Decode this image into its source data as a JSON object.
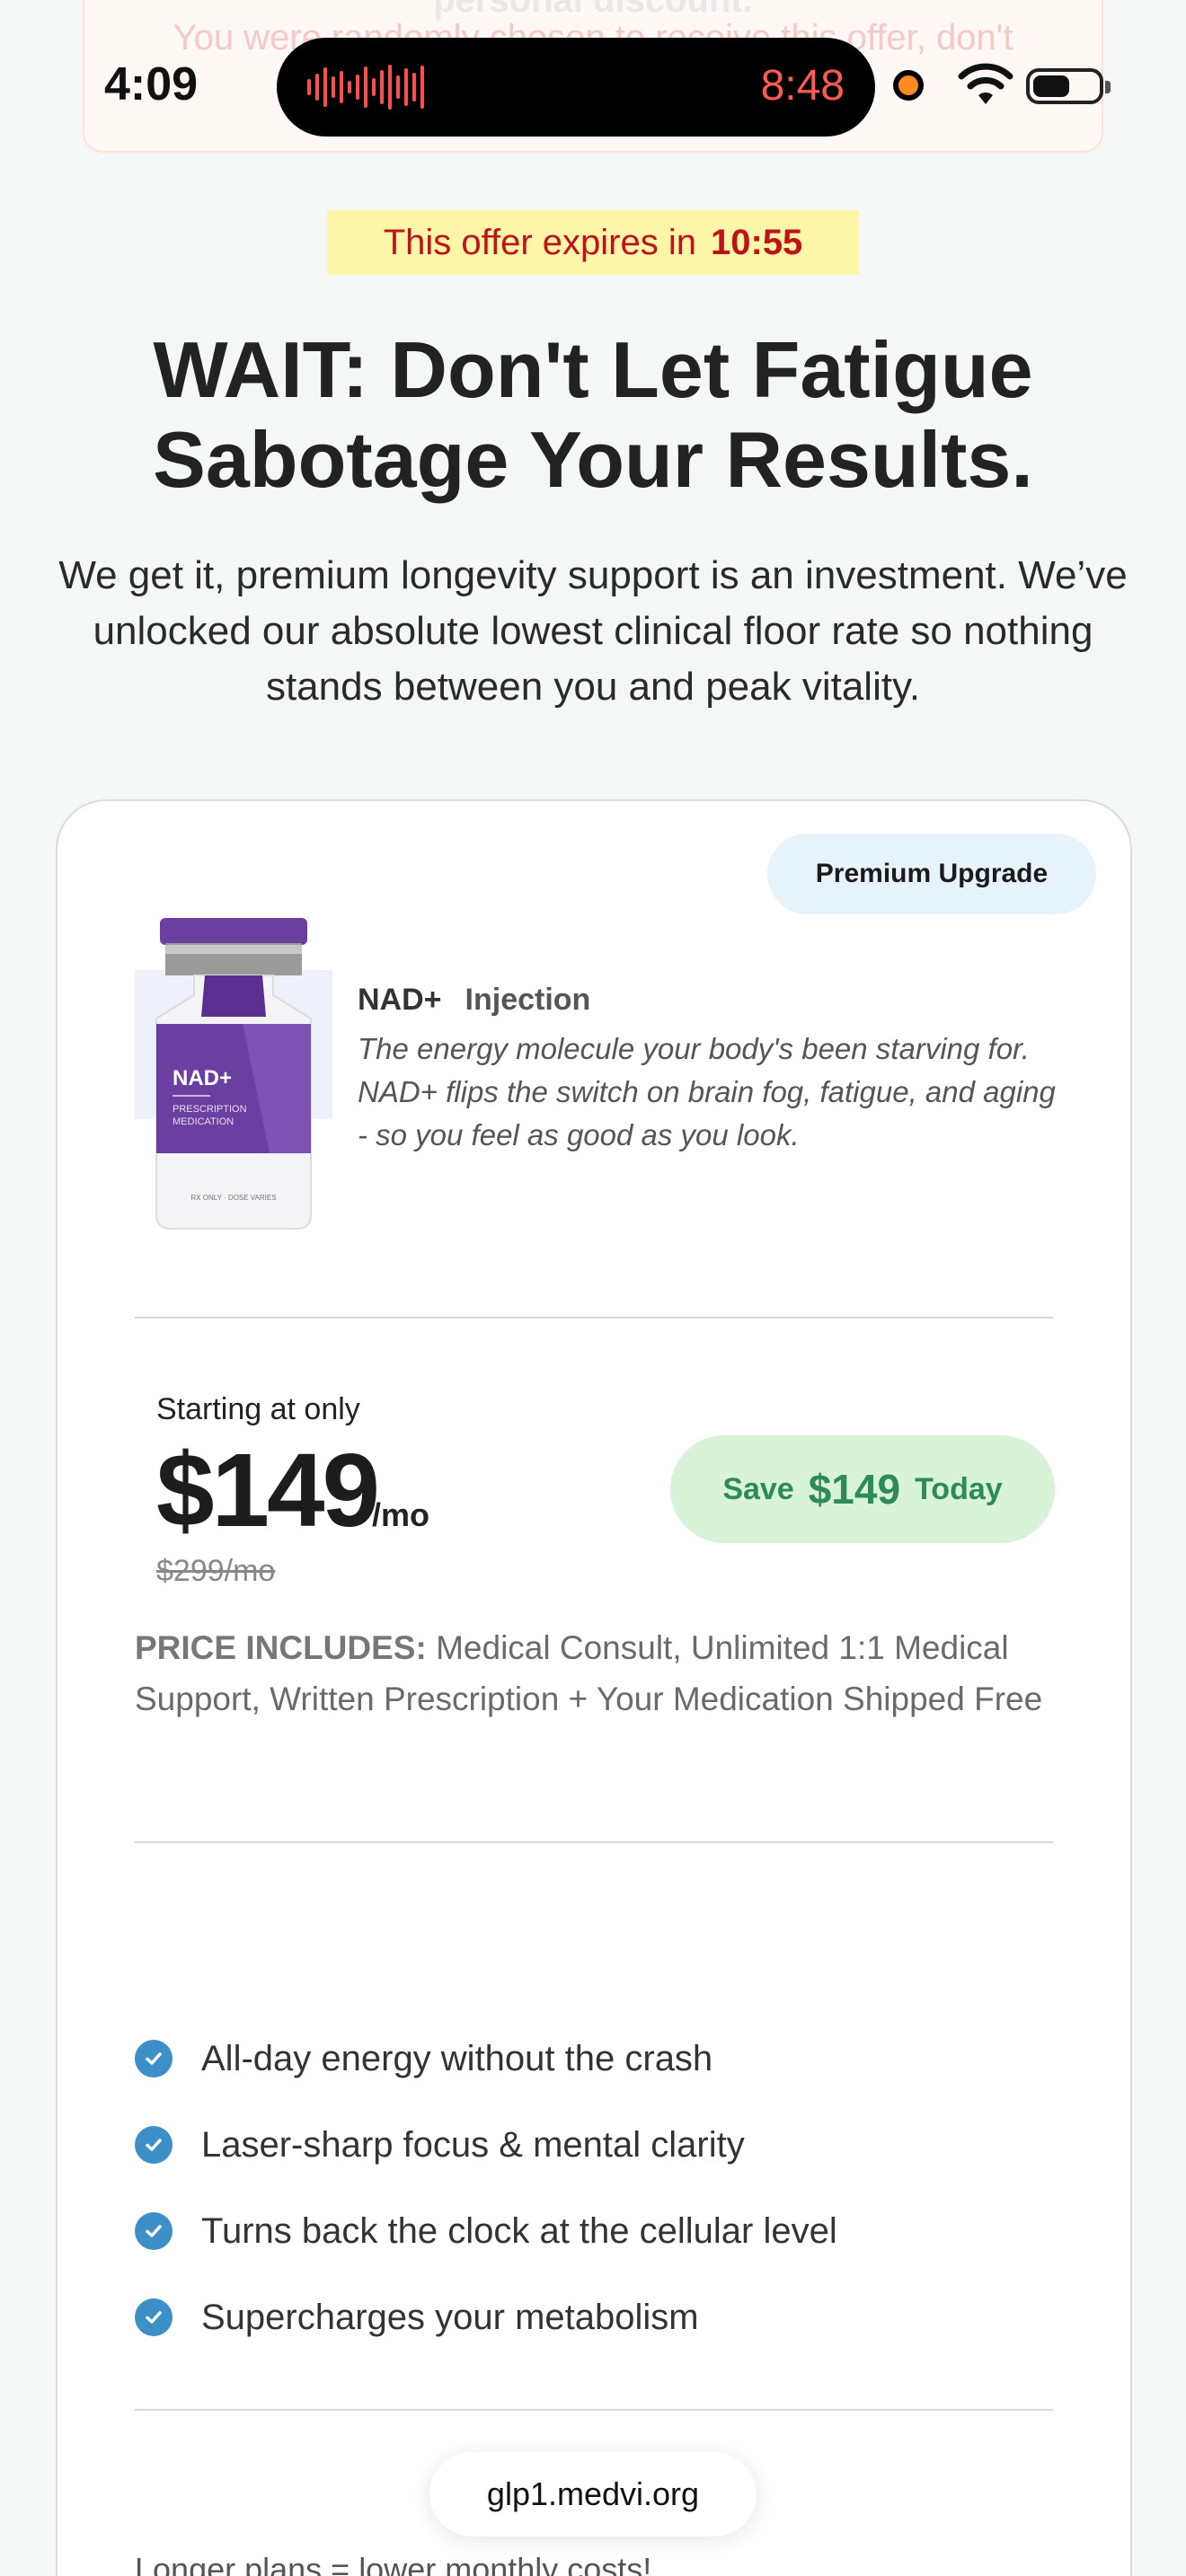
{
  "status_bar": {
    "time": "4:09",
    "recording_timer": "8:48"
  },
  "top_banner": {
    "line1": "personal discount.",
    "line2": "You were randomly chosen to receive this offer, don't"
  },
  "countdown": {
    "label": "This offer expires in",
    "time": "10:55"
  },
  "headline": "WAIT: Don't Let Fatigue Sabotage Your Results.",
  "subheadline": "We get it, premium longevity support is an investment. We’ve unlocked our absolute lowest clinical floor rate so nothing stands between you and peak vitality.",
  "card": {
    "badge": "Premium Upgrade",
    "product": {
      "name": "NAD+",
      "type": "Injection",
      "description": "The energy molecule your body's been starving for. NAD+ flips the switch on brain fog, fatigue, and aging - so you feel as good as you look.",
      "vial_label": "NAD+",
      "vial_sub1": "PRESCRIPTION",
      "vial_sub2": "MEDICATION",
      "vial_foot": "RX ONLY · DOSE VARIES"
    },
    "pricing": {
      "starting_label": "Starting at only",
      "price": "$149",
      "unit": "/mo",
      "old_price": "$299/mo",
      "save_prefix": "Save",
      "save_amount": "$149",
      "save_suffix": "Today"
    },
    "includes_label": "PRICE INCLUDES:",
    "includes_text": "Medical Consult, Unlimited 1:1 Medical Support, Written Prescription + Your Medication Shipped Free",
    "benefits": [
      "All-day energy without the crash",
      "Laser-sharp focus & mental clarity",
      "Turns back the clock at the cellular level",
      "Supercharges your metabolism"
    ],
    "plans_note": "Longer plans = lower monthly costs!"
  },
  "browser": {
    "url": "glp1.medvi.org"
  },
  "colors": {
    "countdown_bg": "#fdf6a8",
    "countdown_text": "#c0121a",
    "save_bg": "#d8f3d8",
    "save_text": "#2e8b57",
    "check": "#3d8fc7",
    "badge_bg": "#e6f3fb",
    "vial_purple": "#6b3fa0"
  }
}
